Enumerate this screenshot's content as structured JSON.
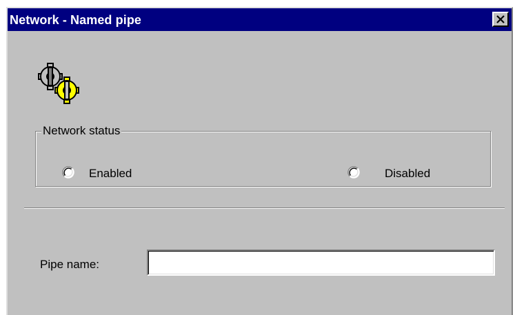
{
  "window": {
    "title": "Network - Named pipe",
    "close_label": "×"
  },
  "network_status": {
    "legend": "Network status",
    "options": [
      {
        "label": "Enabled",
        "selected": false
      },
      {
        "label": "Disabled",
        "selected": false
      }
    ]
  },
  "pipe": {
    "label": "Pipe name:",
    "value": ""
  },
  "icons": {
    "app": "gears-icon",
    "close": "close-icon"
  },
  "colors": {
    "titlebar": "#000080",
    "face": "#c0c0c0",
    "gear_gray": "#c0c0c0",
    "gear_yellow": "#ffff00"
  }
}
